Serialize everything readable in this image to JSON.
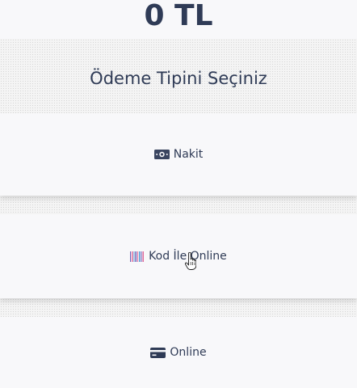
{
  "payment": {
    "amount": "0 TL",
    "title": "Ödeme Tipini Seçiniz",
    "options": [
      {
        "label": "Nakit",
        "icon": "cash-icon"
      },
      {
        "label": "Kod İle Online",
        "icon": "barcode-icon"
      },
      {
        "label": "Online",
        "icon": "credit-card-icon"
      }
    ]
  },
  "colors": {
    "text": "#2f3b56",
    "panel": "#f8f8fa",
    "background": "#f4f4f4"
  }
}
